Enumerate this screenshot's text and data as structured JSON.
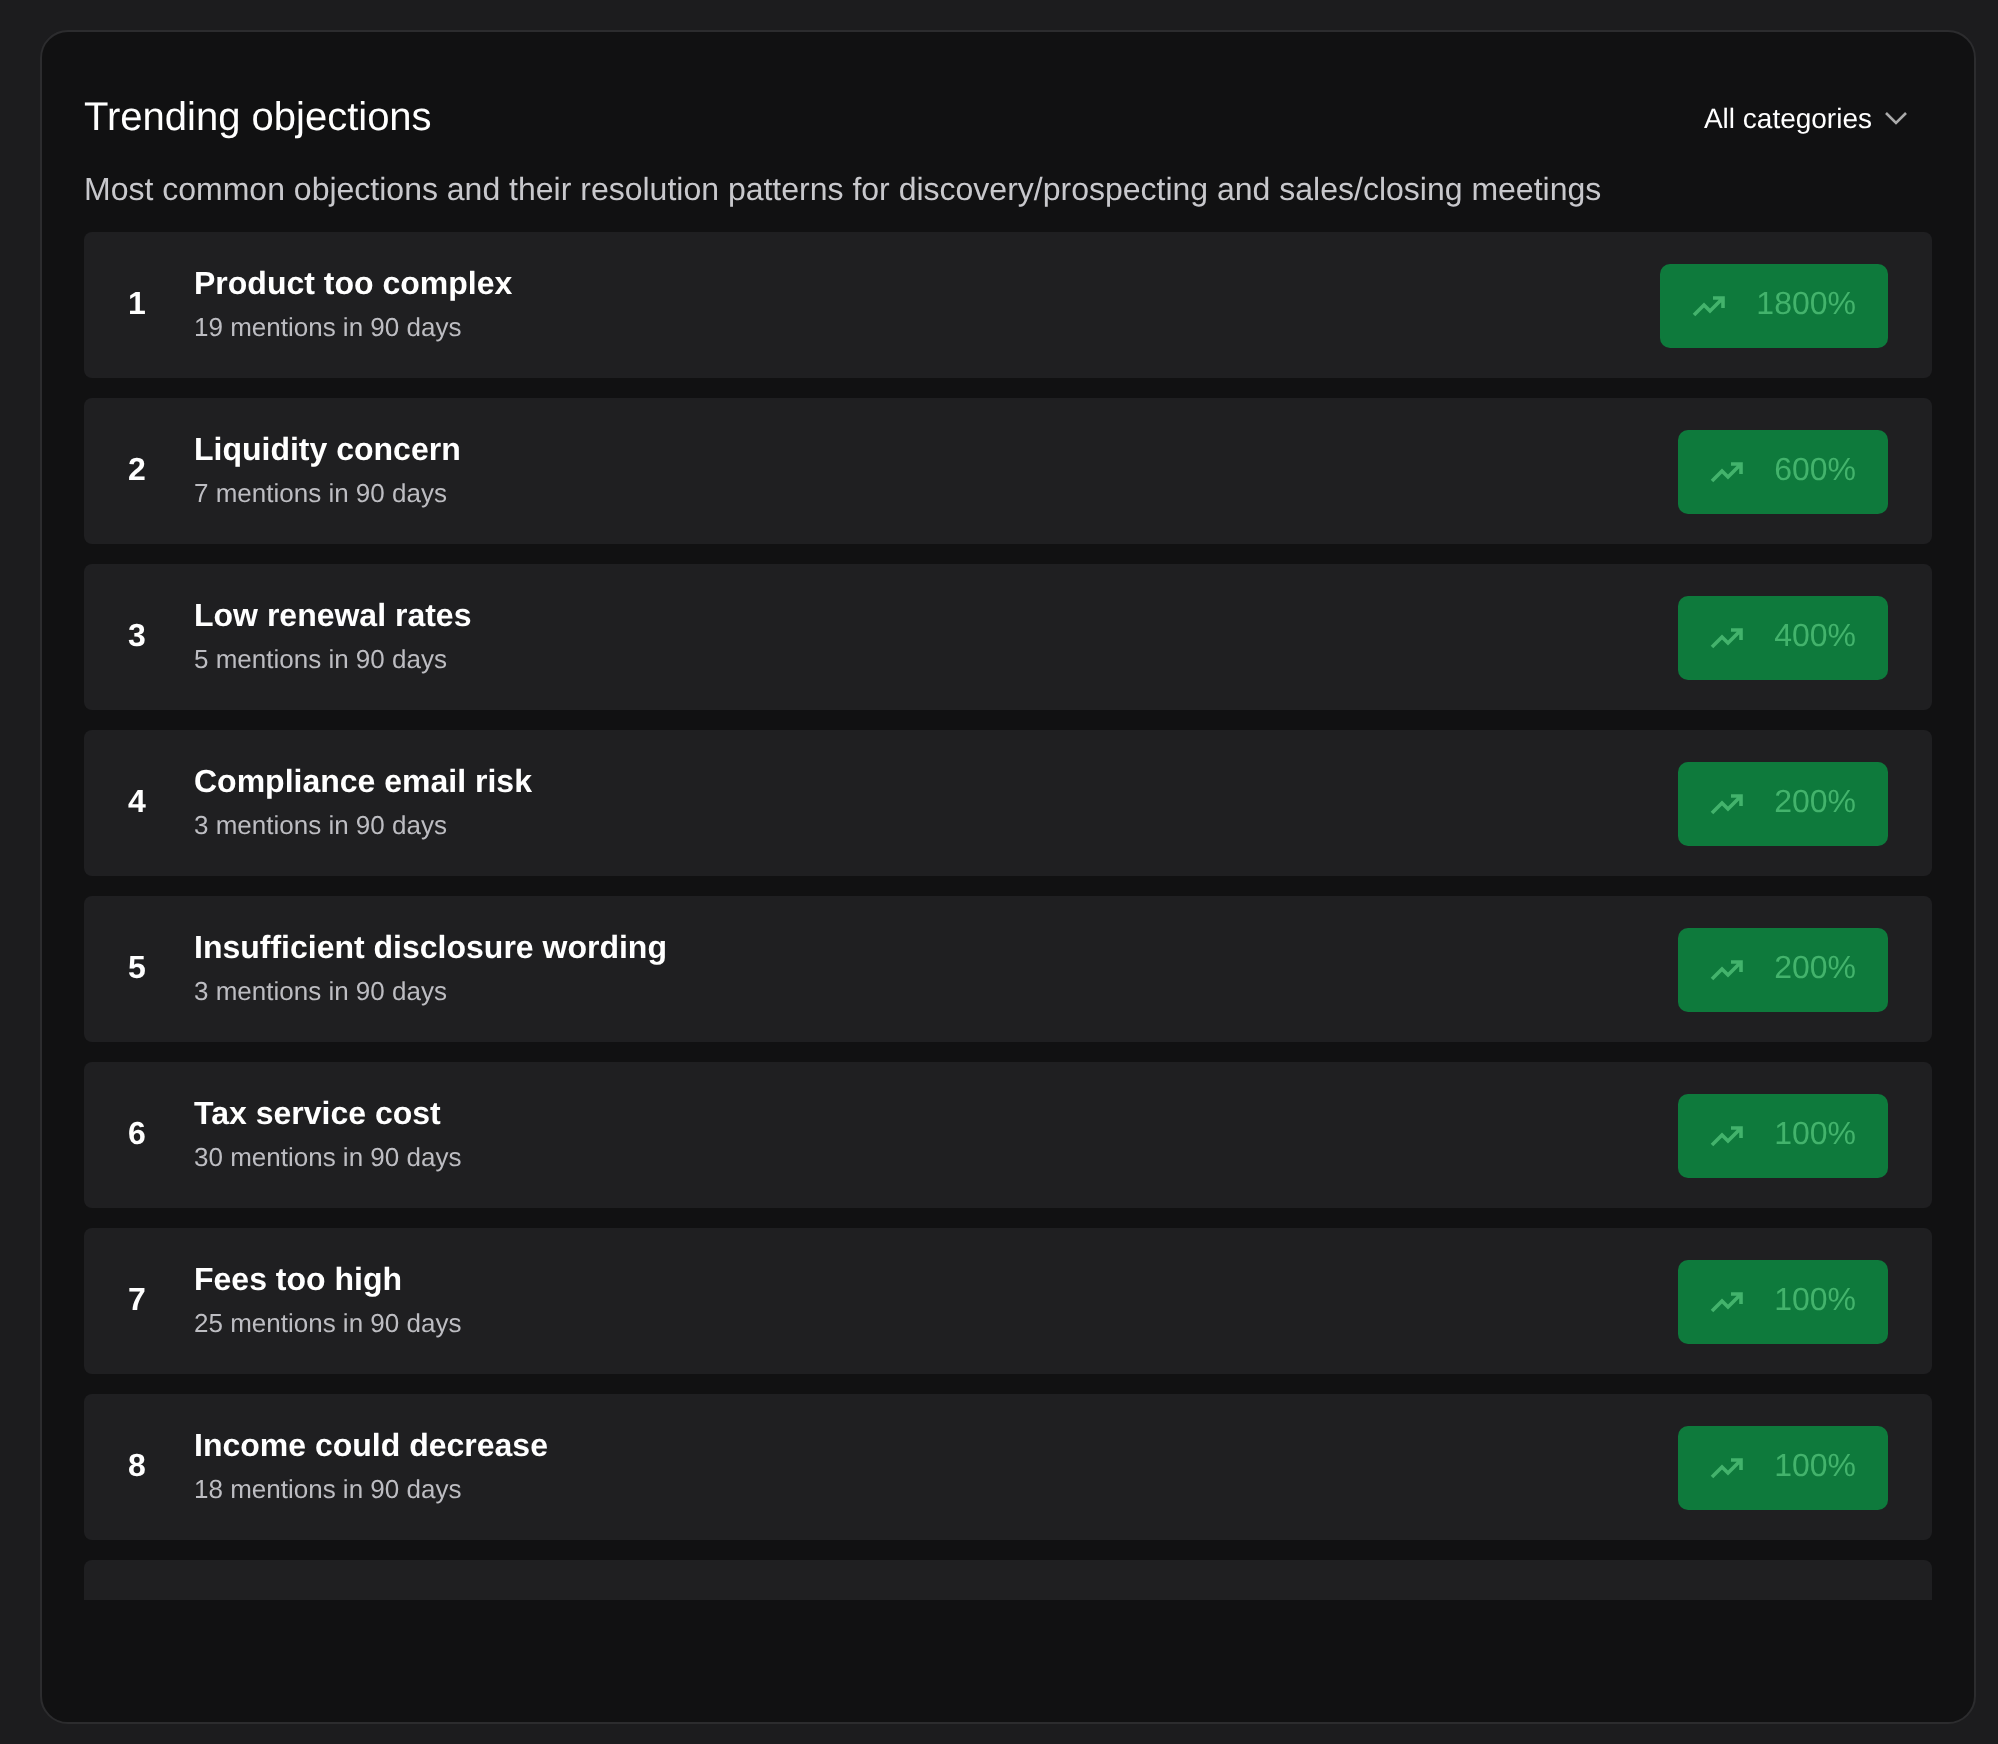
{
  "title": "Trending objections",
  "filter": {
    "label": "All categories"
  },
  "description": "Most common objections and their resolution patterns for discovery/prospecting and sales/closing meetings",
  "objections": [
    {
      "rank": "1",
      "name": "Product too complex",
      "mentions": "19 mentions in 90 days",
      "trend": "1800%"
    },
    {
      "rank": "2",
      "name": "Liquidity concern",
      "mentions": "7 mentions in 90 days",
      "trend": "600%"
    },
    {
      "rank": "3",
      "name": "Low renewal rates",
      "mentions": "5 mentions in 90 days",
      "trend": "400%"
    },
    {
      "rank": "4",
      "name": "Compliance email risk",
      "mentions": "3 mentions in 90 days",
      "trend": "200%"
    },
    {
      "rank": "5",
      "name": "Insufficient disclosure wording",
      "mentions": "3 mentions in 90 days",
      "trend": "200%"
    },
    {
      "rank": "6",
      "name": "Tax service cost",
      "mentions": "30 mentions in 90 days",
      "trend": "100%"
    },
    {
      "rank": "7",
      "name": "Fees too high",
      "mentions": "25 mentions in 90 days",
      "trend": "100%"
    },
    {
      "rank": "8",
      "name": "Income could decrease",
      "mentions": "18 mentions in 90 days",
      "trend": "100%"
    }
  ]
}
